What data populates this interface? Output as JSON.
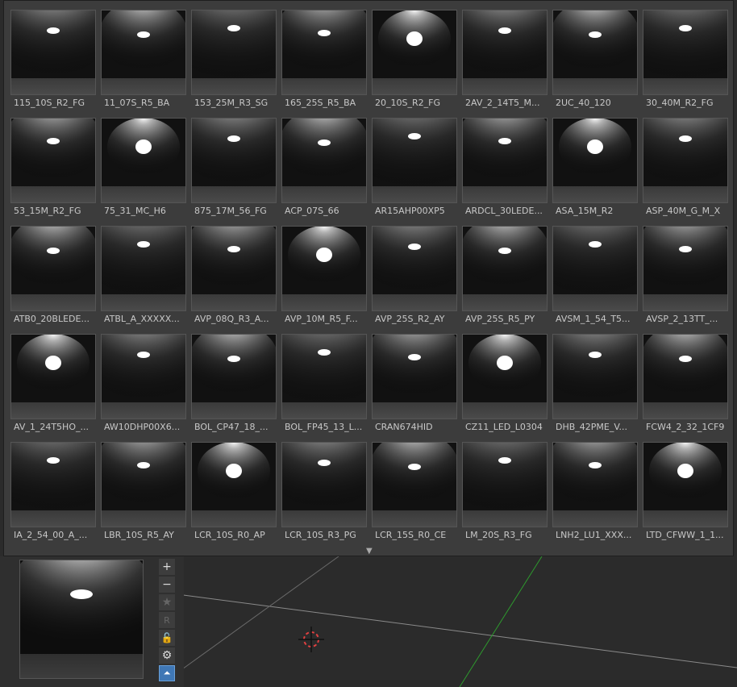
{
  "ies_items": [
    [
      "115_10S_R2_FG",
      "11_07S_R5_BA",
      "153_25M_R3_SG",
      "165_25S_R5_BA",
      "20_10S_R2_FG",
      "2AV_2_14T5_M...",
      "2UC_40_120",
      "30_40M_R2_FG"
    ],
    [
      "53_15M_R2_FG",
      "75_31_MC_H6",
      "875_17M_56_FG",
      "ACP_07S_66",
      "AR15AHP00XP5",
      "ARDCL_30LEDE...",
      "ASA_15M_R2",
      "ASP_40M_G_M_X"
    ],
    [
      "ATB0_20BLEDE...",
      "ATBL_A_XXXXX...",
      "AVP_08Q_R3_A...",
      "AVP_10M_R5_F...",
      "AVP_25S_R2_AY",
      "AVP_25S_R5_PY",
      "AVSM_1_54_T5...",
      "AVSP_2_13TT_..."
    ],
    [
      "AV_1_24T5HO_...",
      "AW10DHP00X6...",
      "BOL_CP47_18_...",
      "BOL_FP45_13_L...",
      "CRAN674HID",
      "CZ11_LED_L0304",
      "DHB_42PME_V...",
      "FCW4_2_32_1CF9"
    ],
    [
      "IA_2_54_00_A_...",
      "LBR_10S_R5_AY",
      "LCR_10S_R0_AP",
      "LCR_10S_R3_PG",
      "LCR_15S_R0_CE",
      "LM_20S_R3_FG",
      "LNH2_LU1_XXX...",
      "LTD_CFWW_1_1..."
    ]
  ],
  "more_indicator": "▼",
  "toolbar": {
    "add": "+",
    "remove": "−",
    "favorite": "★",
    "rename": "R",
    "lock": "🔓",
    "settings": "⚙",
    "collapse": "⏶"
  }
}
